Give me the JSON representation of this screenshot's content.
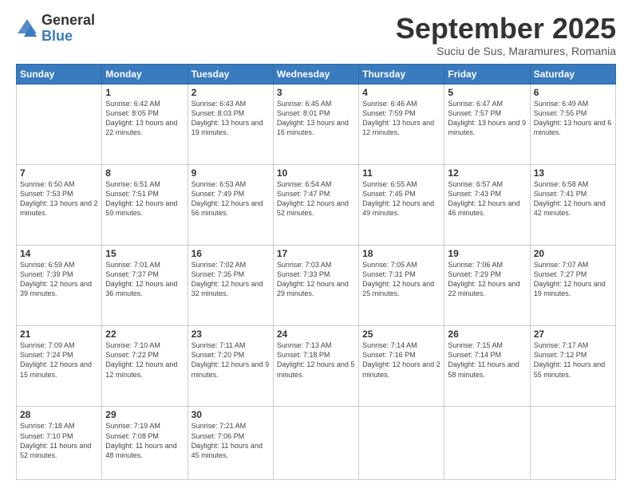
{
  "logo": {
    "general": "General",
    "blue": "Blue"
  },
  "title": "September 2025",
  "subtitle": "Suciu de Sus, Maramures, Romania",
  "weekdays": [
    "Sunday",
    "Monday",
    "Tuesday",
    "Wednesday",
    "Thursday",
    "Friday",
    "Saturday"
  ],
  "weeks": [
    [
      {
        "day": "",
        "sunrise": "",
        "sunset": "",
        "daylight": ""
      },
      {
        "day": "1",
        "sunrise": "Sunrise: 6:42 AM",
        "sunset": "Sunset: 8:05 PM",
        "daylight": "Daylight: 13 hours and 22 minutes."
      },
      {
        "day": "2",
        "sunrise": "Sunrise: 6:43 AM",
        "sunset": "Sunset: 8:03 PM",
        "daylight": "Daylight: 13 hours and 19 minutes."
      },
      {
        "day": "3",
        "sunrise": "Sunrise: 6:45 AM",
        "sunset": "Sunset: 8:01 PM",
        "daylight": "Daylight: 13 hours and 16 minutes."
      },
      {
        "day": "4",
        "sunrise": "Sunrise: 6:46 AM",
        "sunset": "Sunset: 7:59 PM",
        "daylight": "Daylight: 13 hours and 12 minutes."
      },
      {
        "day": "5",
        "sunrise": "Sunrise: 6:47 AM",
        "sunset": "Sunset: 7:57 PM",
        "daylight": "Daylight: 13 hours and 9 minutes."
      },
      {
        "day": "6",
        "sunrise": "Sunrise: 6:49 AM",
        "sunset": "Sunset: 7:55 PM",
        "daylight": "Daylight: 13 hours and 6 minutes."
      }
    ],
    [
      {
        "day": "7",
        "sunrise": "Sunrise: 6:50 AM",
        "sunset": "Sunset: 7:53 PM",
        "daylight": "Daylight: 13 hours and 2 minutes."
      },
      {
        "day": "8",
        "sunrise": "Sunrise: 6:51 AM",
        "sunset": "Sunset: 7:51 PM",
        "daylight": "Daylight: 12 hours and 59 minutes."
      },
      {
        "day": "9",
        "sunrise": "Sunrise: 6:53 AM",
        "sunset": "Sunset: 7:49 PM",
        "daylight": "Daylight: 12 hours and 56 minutes."
      },
      {
        "day": "10",
        "sunrise": "Sunrise: 6:54 AM",
        "sunset": "Sunset: 7:47 PM",
        "daylight": "Daylight: 12 hours and 52 minutes."
      },
      {
        "day": "11",
        "sunrise": "Sunrise: 6:55 AM",
        "sunset": "Sunset: 7:45 PM",
        "daylight": "Daylight: 12 hours and 49 minutes."
      },
      {
        "day": "12",
        "sunrise": "Sunrise: 6:57 AM",
        "sunset": "Sunset: 7:43 PM",
        "daylight": "Daylight: 12 hours and 46 minutes."
      },
      {
        "day": "13",
        "sunrise": "Sunrise: 6:58 AM",
        "sunset": "Sunset: 7:41 PM",
        "daylight": "Daylight: 12 hours and 42 minutes."
      }
    ],
    [
      {
        "day": "14",
        "sunrise": "Sunrise: 6:59 AM",
        "sunset": "Sunset: 7:39 PM",
        "daylight": "Daylight: 12 hours and 39 minutes."
      },
      {
        "day": "15",
        "sunrise": "Sunrise: 7:01 AM",
        "sunset": "Sunset: 7:37 PM",
        "daylight": "Daylight: 12 hours and 36 minutes."
      },
      {
        "day": "16",
        "sunrise": "Sunrise: 7:02 AM",
        "sunset": "Sunset: 7:35 PM",
        "daylight": "Daylight: 12 hours and 32 minutes."
      },
      {
        "day": "17",
        "sunrise": "Sunrise: 7:03 AM",
        "sunset": "Sunset: 7:33 PM",
        "daylight": "Daylight: 12 hours and 29 minutes."
      },
      {
        "day": "18",
        "sunrise": "Sunrise: 7:05 AM",
        "sunset": "Sunset: 7:31 PM",
        "daylight": "Daylight: 12 hours and 25 minutes."
      },
      {
        "day": "19",
        "sunrise": "Sunrise: 7:06 AM",
        "sunset": "Sunset: 7:29 PM",
        "daylight": "Daylight: 12 hours and 22 minutes."
      },
      {
        "day": "20",
        "sunrise": "Sunrise: 7:07 AM",
        "sunset": "Sunset: 7:27 PM",
        "daylight": "Daylight: 12 hours and 19 minutes."
      }
    ],
    [
      {
        "day": "21",
        "sunrise": "Sunrise: 7:09 AM",
        "sunset": "Sunset: 7:24 PM",
        "daylight": "Daylight: 12 hours and 15 minutes."
      },
      {
        "day": "22",
        "sunrise": "Sunrise: 7:10 AM",
        "sunset": "Sunset: 7:22 PM",
        "daylight": "Daylight: 12 hours and 12 minutes."
      },
      {
        "day": "23",
        "sunrise": "Sunrise: 7:11 AM",
        "sunset": "Sunset: 7:20 PM",
        "daylight": "Daylight: 12 hours and 9 minutes."
      },
      {
        "day": "24",
        "sunrise": "Sunrise: 7:13 AM",
        "sunset": "Sunset: 7:18 PM",
        "daylight": "Daylight: 12 hours and 5 minutes."
      },
      {
        "day": "25",
        "sunrise": "Sunrise: 7:14 AM",
        "sunset": "Sunset: 7:16 PM",
        "daylight": "Daylight: 12 hours and 2 minutes."
      },
      {
        "day": "26",
        "sunrise": "Sunrise: 7:15 AM",
        "sunset": "Sunset: 7:14 PM",
        "daylight": "Daylight: 11 hours and 58 minutes."
      },
      {
        "day": "27",
        "sunrise": "Sunrise: 7:17 AM",
        "sunset": "Sunset: 7:12 PM",
        "daylight": "Daylight: 11 hours and 55 minutes."
      }
    ],
    [
      {
        "day": "28",
        "sunrise": "Sunrise: 7:18 AM",
        "sunset": "Sunset: 7:10 PM",
        "daylight": "Daylight: 11 hours and 52 minutes."
      },
      {
        "day": "29",
        "sunrise": "Sunrise: 7:19 AM",
        "sunset": "Sunset: 7:08 PM",
        "daylight": "Daylight: 11 hours and 48 minutes."
      },
      {
        "day": "30",
        "sunrise": "Sunrise: 7:21 AM",
        "sunset": "Sunset: 7:06 PM",
        "daylight": "Daylight: 11 hours and 45 minutes."
      },
      {
        "day": "",
        "sunrise": "",
        "sunset": "",
        "daylight": ""
      },
      {
        "day": "",
        "sunrise": "",
        "sunset": "",
        "daylight": ""
      },
      {
        "day": "",
        "sunrise": "",
        "sunset": "",
        "daylight": ""
      },
      {
        "day": "",
        "sunrise": "",
        "sunset": "",
        "daylight": ""
      }
    ]
  ]
}
